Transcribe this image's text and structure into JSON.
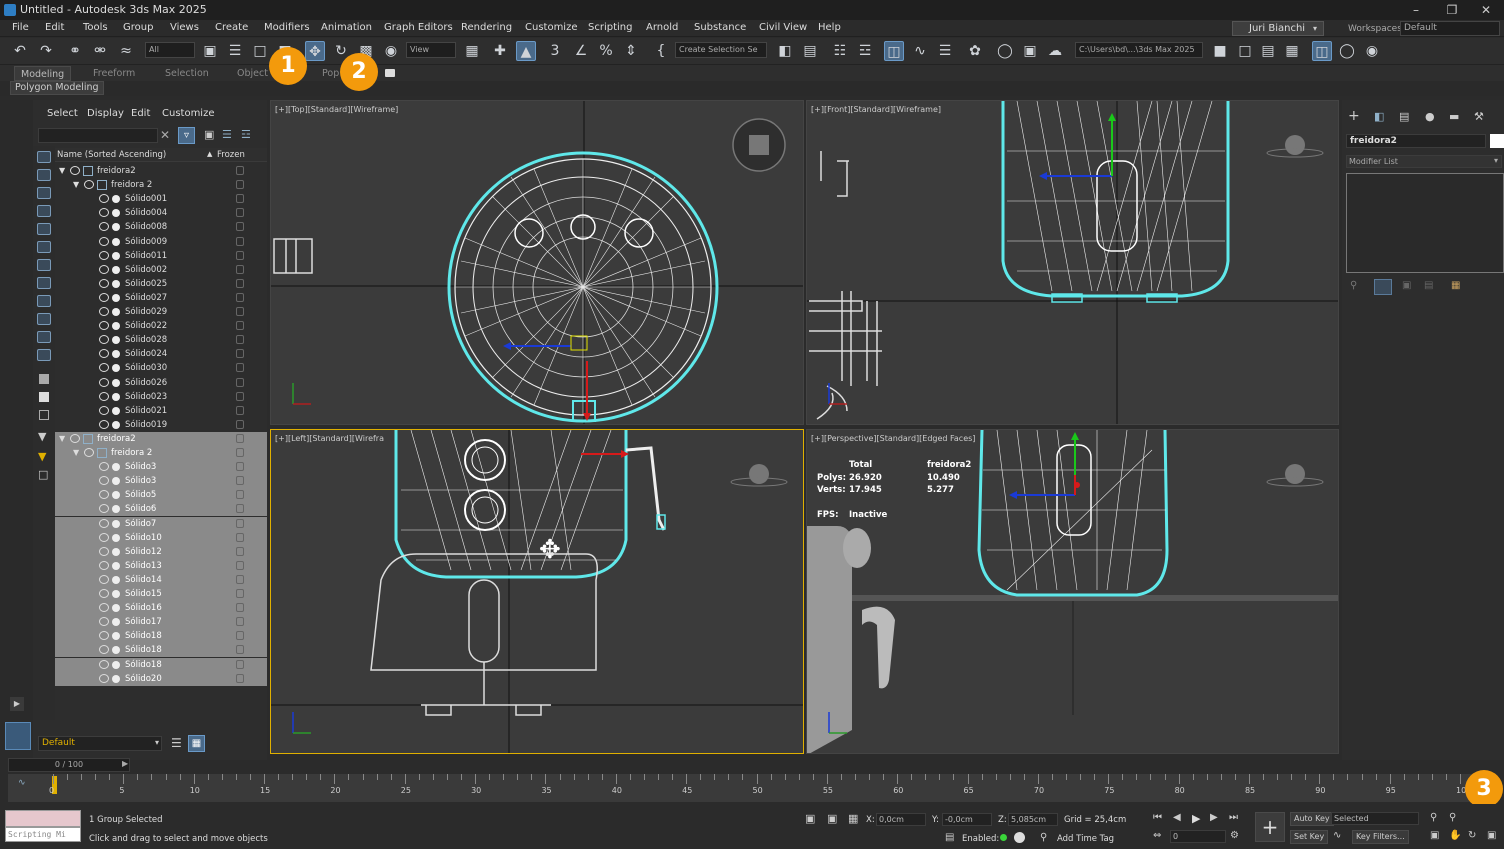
{
  "window": {
    "title": "Untitled - Autodesk 3ds Max 2025"
  },
  "menu": [
    "File",
    "Edit",
    "Tools",
    "Group",
    "Views",
    "Create",
    "Modifiers",
    "Animation",
    "Graph Editors",
    "Rendering",
    "Customize",
    "Scripting",
    "Arnold",
    "Substance",
    "Civil View",
    "Help"
  ],
  "user": "Juri Bianchi",
  "workspaces": {
    "label": "Workspaces:",
    "value": "Default"
  },
  "toolbar": {
    "filter": "All",
    "refcoord": "View",
    "selset": "Create Selection Se",
    "path": "C:\\Users\\bd\\...\\3ds Max 2025"
  },
  "ribbon": {
    "tabs": [
      "Modeling",
      "Freeform",
      "Selection",
      "Object P",
      "Pop"
    ],
    "sub": "Polygon Modeling"
  },
  "badges": [
    "1",
    "2",
    "3"
  ],
  "scene": {
    "tabs": [
      "Select",
      "Display",
      "Edit",
      "Customize"
    ],
    "col_name": "Name (Sorted Ascending)",
    "col_frozen": "Frozen",
    "rows": [
      {
        "n": "freidora2",
        "d": 0,
        "t": "grp"
      },
      {
        "n": "freidora 2",
        "d": 1,
        "t": "grp"
      },
      {
        "n": "Sólido001",
        "d": 2
      },
      {
        "n": "Sólido004",
        "d": 2
      },
      {
        "n": "Sólido008",
        "d": 2
      },
      {
        "n": "Sólido009",
        "d": 2
      },
      {
        "n": "Sólido011",
        "d": 2
      },
      {
        "n": "Sólido002",
        "d": 2
      },
      {
        "n": "Sólido025",
        "d": 2
      },
      {
        "n": "Sólido027",
        "d": 2
      },
      {
        "n": "Sólido029",
        "d": 2
      },
      {
        "n": "Sólido022",
        "d": 2
      },
      {
        "n": "Sólido028",
        "d": 2
      },
      {
        "n": "Sólido024",
        "d": 2
      },
      {
        "n": "Sólido030",
        "d": 2
      },
      {
        "n": "Sólido026",
        "d": 2
      },
      {
        "n": "Sólido023",
        "d": 2
      },
      {
        "n": "Sólido021",
        "d": 2
      },
      {
        "n": "Sólido019",
        "d": 2
      },
      {
        "n": "freidora2",
        "d": 0,
        "t": "grp",
        "s": true
      },
      {
        "n": "freidora 2",
        "d": 1,
        "t": "grp",
        "s": true
      },
      {
        "n": "Sólido3",
        "d": 2,
        "s": true
      },
      {
        "n": "Sólido3",
        "d": 2,
        "s": true
      },
      {
        "n": "Sólido5",
        "d": 2,
        "s": true
      },
      {
        "n": "Sólido6",
        "d": 2,
        "s": true
      },
      {
        "n": "Sólido7",
        "d": 2,
        "s": true
      },
      {
        "n": "Sólido10",
        "d": 2,
        "s": true
      },
      {
        "n": "Sólido12",
        "d": 2,
        "s": true
      },
      {
        "n": "Sólido13",
        "d": 2,
        "s": true
      },
      {
        "n": "Sólido14",
        "d": 2,
        "s": true
      },
      {
        "n": "Sólido15",
        "d": 2,
        "s": true
      },
      {
        "n": "Sólido16",
        "d": 2,
        "s": true
      },
      {
        "n": "Sólido17",
        "d": 2,
        "s": true
      },
      {
        "n": "Sólido18",
        "d": 2,
        "s": true
      },
      {
        "n": "Sólido18",
        "d": 2,
        "s": true
      },
      {
        "n": "Sólido18",
        "d": 2,
        "s": true
      },
      {
        "n": "Sólido20",
        "d": 2,
        "s": true
      }
    ],
    "layer": "Default"
  },
  "viewports": {
    "top": "[+][Top][Standard][Wireframe]",
    "front": "[+][Front][Standard][Wireframe]",
    "left": "[+][Left][Standard][Wirefra",
    "persp": "[+][Perspective][Standard][Edged Faces]",
    "stats": {
      "total": "Total",
      "obj": "freidora2",
      "polys_l": "Polys:",
      "polys_t": "26.920",
      "polys_o": "10.490",
      "verts_l": "Verts:",
      "verts_t": "17.945",
      "verts_o": "5.277",
      "fps_l": "FPS:",
      "fps_v": "Inactive"
    }
  },
  "cmd": {
    "object": "freidora2",
    "modlist": "Modifier List"
  },
  "time": {
    "slider": "0 / 100",
    "ticks": [
      "0",
      "5",
      "10",
      "15",
      "20",
      "25",
      "30",
      "35",
      "40",
      "45",
      "50",
      "55",
      "60",
      "65",
      "70",
      "75",
      "80",
      "85",
      "90",
      "95",
      "100"
    ]
  },
  "status": {
    "script": "Scripting Mi",
    "selected": "1 Group Selected",
    "prompt": "Click and drag to select and move objects",
    "x_l": "X:",
    "x": "0,0cm",
    "y_l": "Y:",
    "y": "-0,0cm",
    "z_l": "Z:",
    "z": "5,085cm",
    "grid": "Grid = 25,4cm",
    "enabled": "Enabled:",
    "addtag": "Add Time Tag",
    "autokey": "Auto Key",
    "setkey": "Set Key",
    "keymode": "Selected",
    "keyfilters": "Key Filters...",
    "frame": "0"
  }
}
